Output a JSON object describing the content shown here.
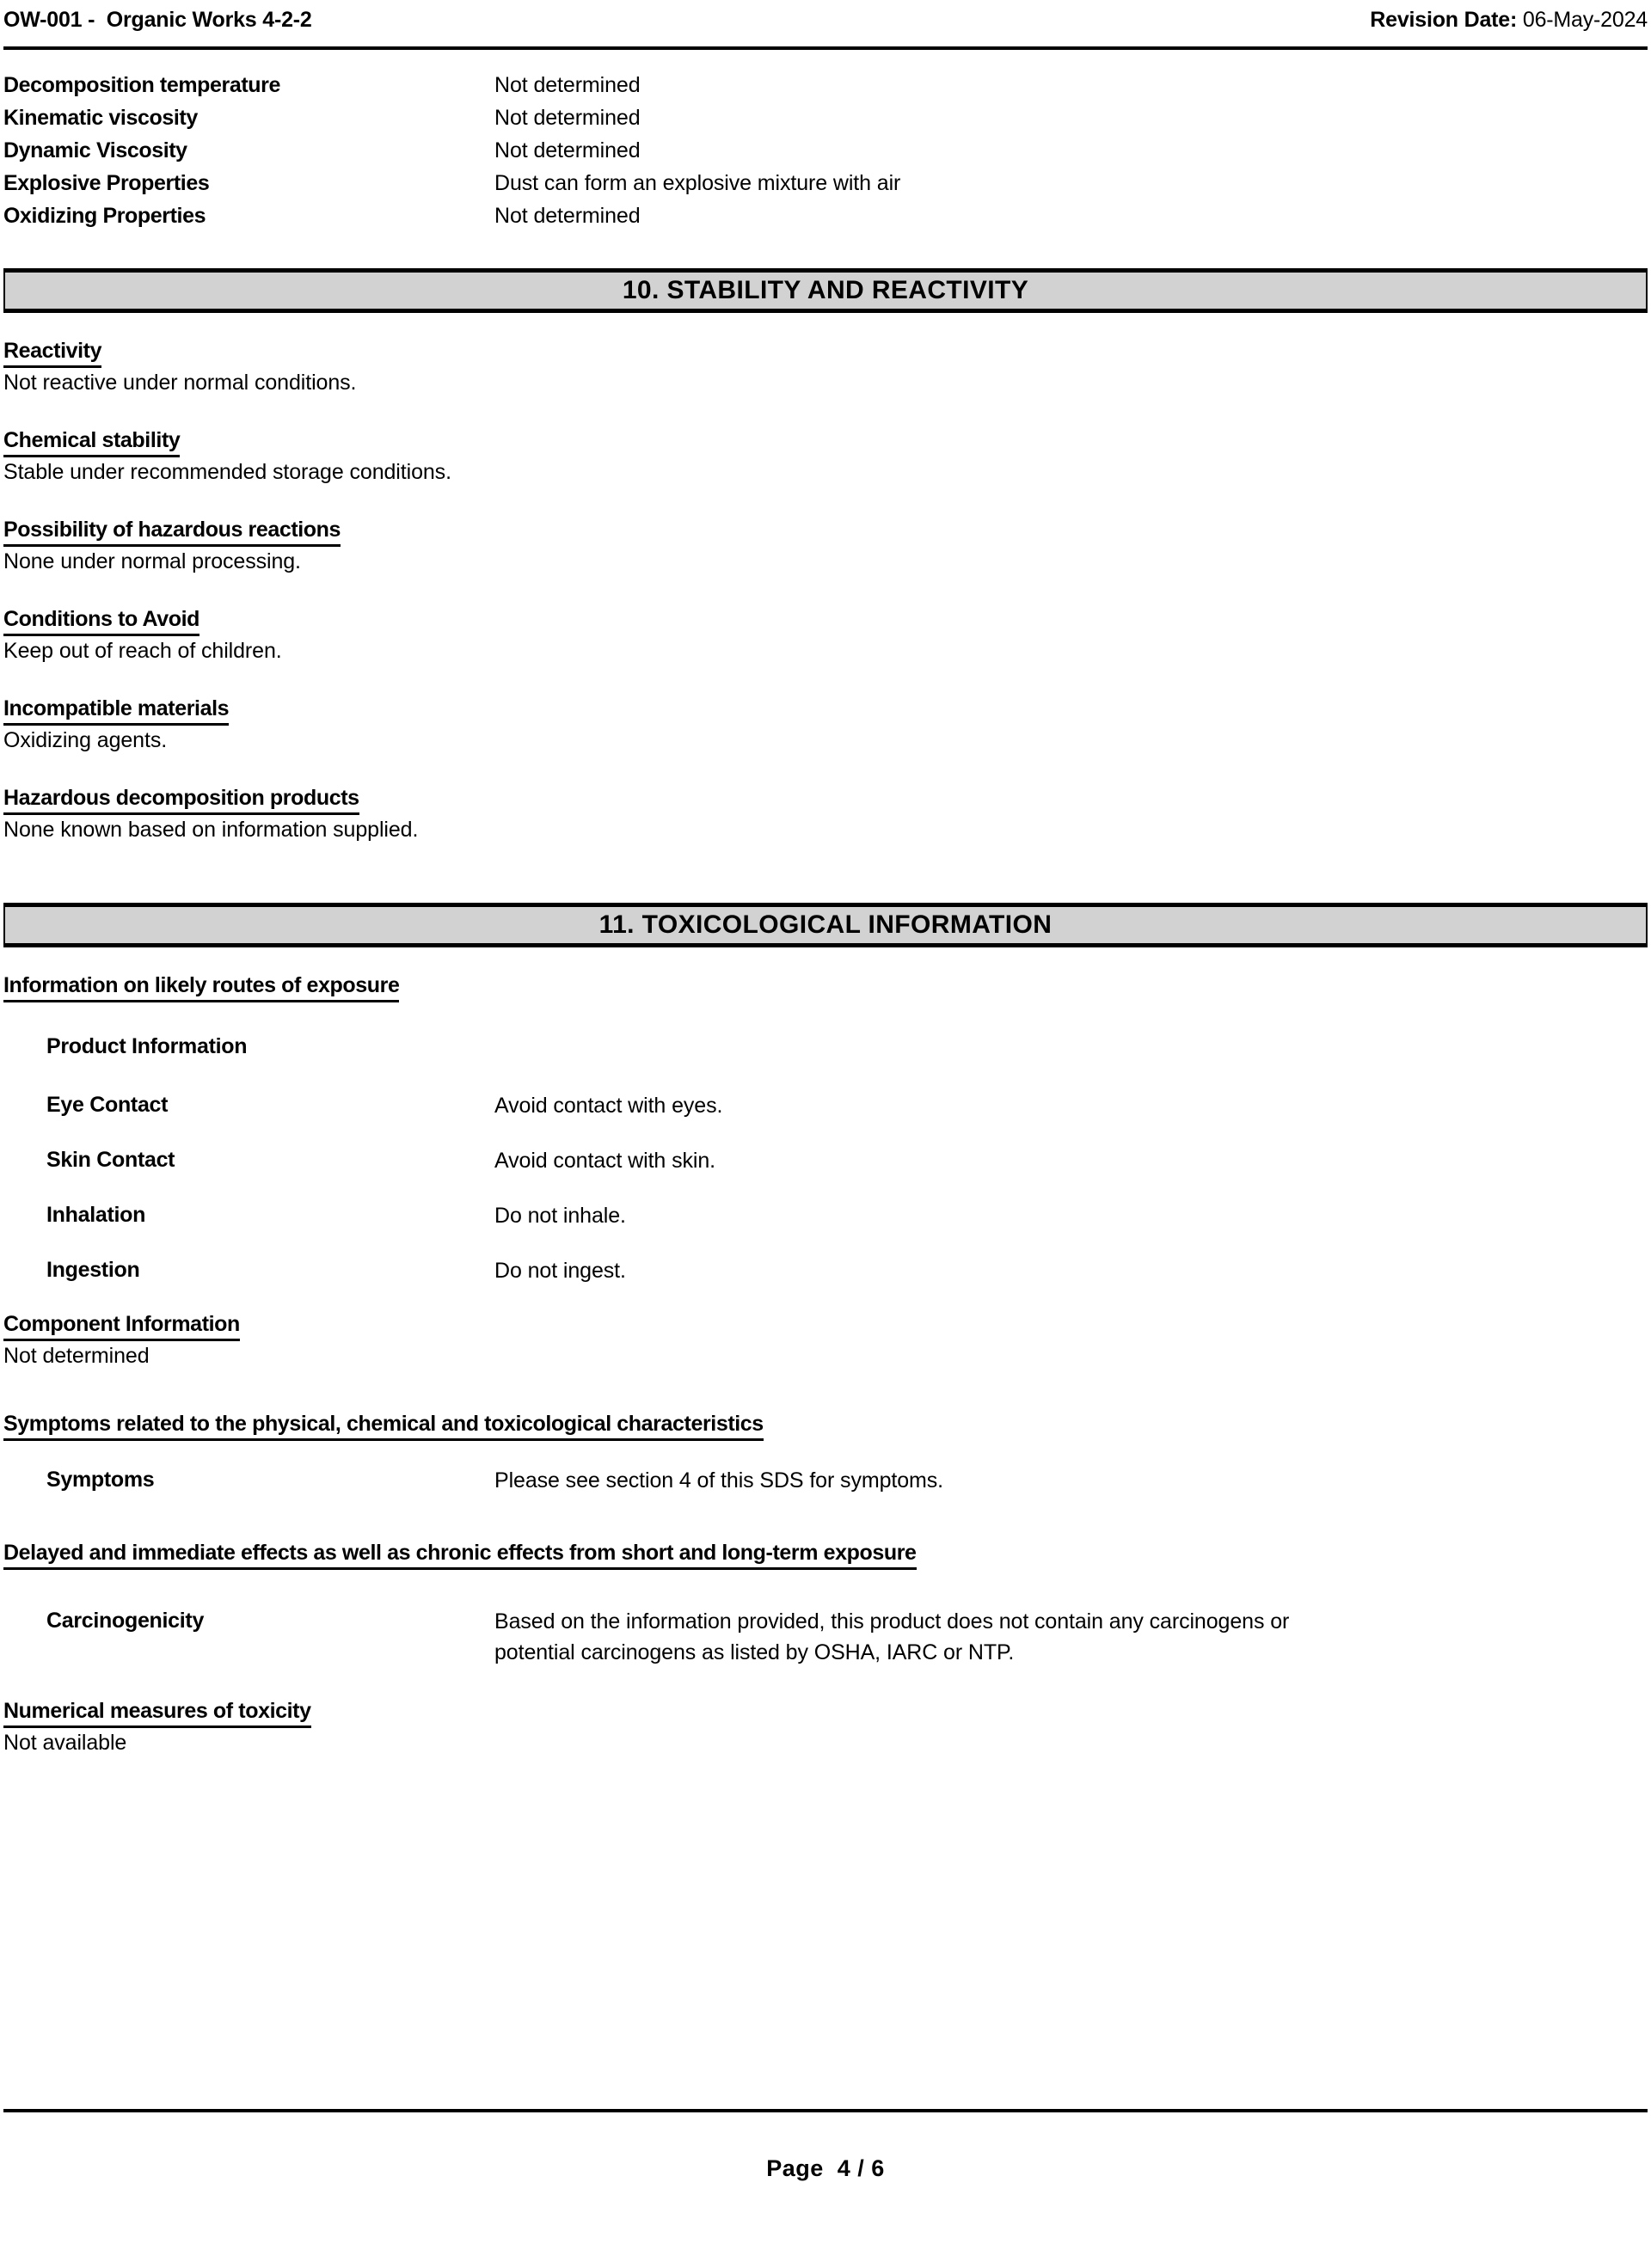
{
  "header": {
    "doc_id_and_name": "OW-001 -  Organic Works 4-2-2",
    "revision_label": "Revision Date:",
    "revision_date": "06-May-2024"
  },
  "physical_properties": {
    "rows": [
      {
        "label": "Decomposition temperature",
        "value": "Not determined"
      },
      {
        "label": "Kinematic viscosity",
        "value": "Not determined"
      },
      {
        "label": "Dynamic Viscosity",
        "value": "Not determined"
      },
      {
        "label": "Explosive Properties",
        "value": "Dust can form an explosive mixture with air"
      },
      {
        "label": "Oxidizing Properties",
        "value": "Not determined"
      }
    ]
  },
  "section10": {
    "title": "10. STABILITY AND REACTIVITY",
    "blocks": [
      {
        "heading": "Reactivity",
        "text": "Not reactive under normal conditions."
      },
      {
        "heading": "Chemical stability",
        "text": "Stable under recommended storage conditions."
      },
      {
        "heading": "Possibility of hazardous reactions",
        "text": "None under normal processing."
      },
      {
        "heading": "Conditions to Avoid",
        "text": "Keep out of reach of children."
      },
      {
        "heading": "Incompatible materials",
        "text": "Oxidizing agents."
      },
      {
        "heading": "Hazardous decomposition products",
        "text": "None known based on information supplied."
      }
    ]
  },
  "section11": {
    "title": "11. TOXICOLOGICAL INFORMATION",
    "routes_heading": "Information on likely routes of exposure",
    "product_information_label": "Product Information",
    "routes": [
      {
        "label": "Eye Contact",
        "value": "Avoid contact with eyes."
      },
      {
        "label": "Skin Contact",
        "value": "Avoid contact with skin."
      },
      {
        "label": "Inhalation",
        "value": "Do not inhale."
      },
      {
        "label": "Ingestion",
        "value": "Do not ingest."
      }
    ],
    "component_information_heading": "Component Information",
    "component_information_text": "Not determined",
    "symptoms_heading": "Symptoms related to the physical, chemical and toxicological characteristics",
    "symptoms_label": "Symptoms",
    "symptoms_value": "Please see section 4 of this SDS for symptoms.",
    "delayed_heading": "Delayed and immediate effects as well as chronic effects from short and long-term exposure",
    "carcinogenicity_label": "Carcinogenicity",
    "carcinogenicity_line1": "Based on the information provided, this product does not contain any carcinogens or",
    "carcinogenicity_line2": "potential carcinogens as listed by OSHA, IARC or NTP.",
    "numerical_heading": "Numerical measures of toxicity",
    "numerical_text": "Not available"
  },
  "footer": {
    "page_label": "Page  4 / 6"
  }
}
